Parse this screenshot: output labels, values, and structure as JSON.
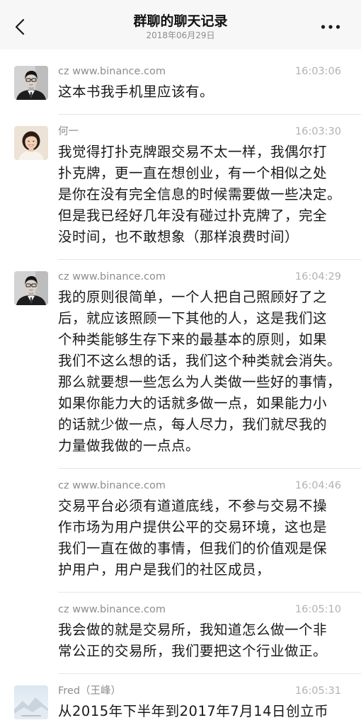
{
  "header": {
    "back_icon": "back-chevron-icon",
    "title": "群聊的聊天记录",
    "date": "2018年06月29日",
    "more_icon": "more-dots-icon"
  },
  "colors": {
    "header_bg": "#f7f7f7",
    "page_bg": "#ffffff",
    "message_text": "#191919",
    "sender_text": "#8d8d8d",
    "time_text": "#b2b2b2",
    "divider": "#e6e6e6"
  },
  "messages": [
    {
      "sender": "cz www.binance.com",
      "time": "16:03:06",
      "avatar": "avatar-cz-photo",
      "lines": [
        "这本书我手机里应该有。"
      ]
    },
    {
      "sender": "何一",
      "time": "16:03:30",
      "avatar": "avatar-he-yi-photo",
      "lines": [
        "我觉得打扑克牌跟交易不太一样，我偶尔打",
        "扑克牌，更一直在想创业，有一个相似之处",
        "是你在没有完全信息的时候需要做一些决定。",
        "但是我已经好几年没有碰过扑克牌了，完全",
        "没时间，也不敢想象（那样浪费时间）"
      ]
    },
    {
      "sender": "cz www.binance.com",
      "time": "16:04:29",
      "avatar": "avatar-cz-photo",
      "lines": [
        "我的原则很简单，一个人把自己照顾好了之",
        "后，就应该照顾一下其他的人，这是我们这",
        "个种类能够生存下来的最基本的原则，如果",
        "我们不这么想的话，我们这个种类就会消失。",
        "那么就要想一些怎么为人类做一些好的事情，",
        "如果你能力大的话就多做一点，如果能力小",
        "的话就少做一点，每人尽力，我们就尽我的",
        "力量做我做的一点点。"
      ]
    },
    {
      "sender": "cz www.binance.com",
      "time": "16:04:46",
      "lines": [
        "交易平台必须有道道底线，不参与交易不操",
        "作市场为用户提供公平的交易环境，这也是",
        "我们一直在做的事情，但我们的价值观是保",
        "护用户，用户是我们的社区成员，"
      ]
    },
    {
      "sender": "cz www.binance.com",
      "time": "16:05:10",
      "lines": [
        "我会做的就是交易所，我知道怎么做一个非",
        "常公正的交易所，我们要把这个行业做正。"
      ]
    },
    {
      "sender": "Fred（王峰）",
      "time": "16:05:31",
      "avatar": "avatar-fred-photo",
      "lines": [
        "从2015年下半年到2017年7月14日创立币"
      ]
    }
  ]
}
